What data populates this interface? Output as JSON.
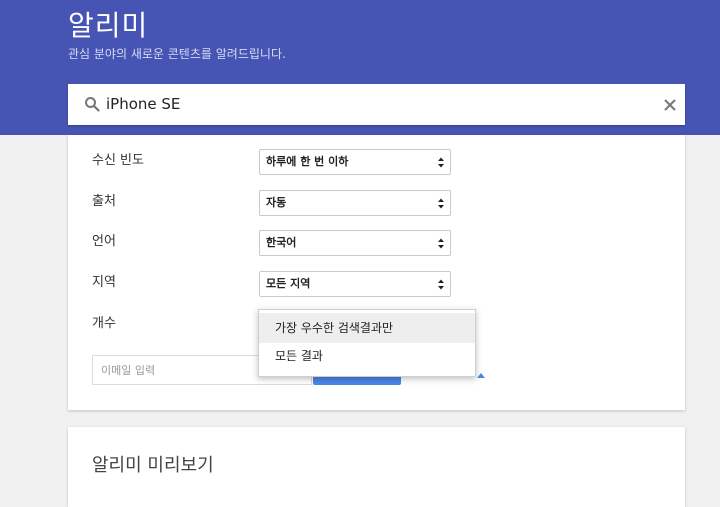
{
  "header": {
    "title": "알리미",
    "subtitle": "관심 분야의 새로운 콘텐츠를 알려드립니다.",
    "color": "#4654b4"
  },
  "search": {
    "value": "iPhone SE",
    "icon": "search-icon",
    "clear_icon": "close-icon"
  },
  "options": {
    "frequency": {
      "label": "수신 빈도",
      "value": "하루에 한 번 이하"
    },
    "source": {
      "label": "출처",
      "value": "자동"
    },
    "language": {
      "label": "언어",
      "value": "한국어"
    },
    "region": {
      "label": "지역",
      "value": "모든 지역"
    },
    "count": {
      "label": "개수"
    }
  },
  "dropdown": {
    "items": [
      "가장 우수한 검색결과만",
      "모든 결과"
    ],
    "selected_index": 0
  },
  "email": {
    "placeholder": "이메일 입력"
  },
  "accent": "#4a86e8",
  "preview": {
    "title": "알리미 미리보기"
  }
}
